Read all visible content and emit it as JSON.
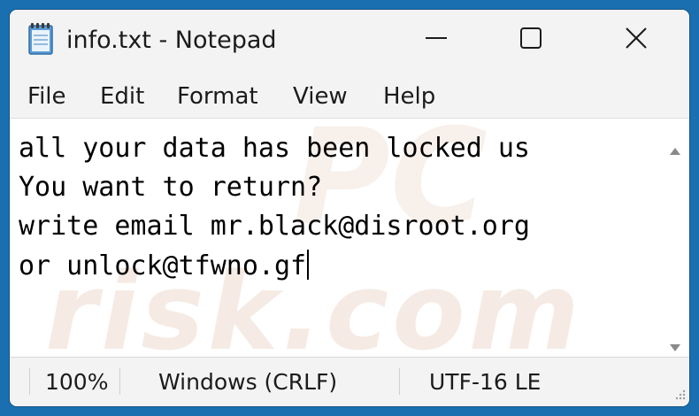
{
  "window": {
    "title": "info.txt - Notepad"
  },
  "menu": {
    "items": [
      "File",
      "Edit",
      "Format",
      "View",
      "Help"
    ]
  },
  "editor": {
    "lines": [
      "all your data has been locked us",
      "You want to return?",
      "write email mr.black@disroot.org",
      "or unlock@tfwno.gf"
    ]
  },
  "watermark": {
    "text1": "PC",
    "text2": "risk.com"
  },
  "status": {
    "zoom": "100%",
    "line_ending": "Windows (CRLF)",
    "encoding": "UTF-16 LE"
  },
  "icons": {
    "app": "notepad-icon",
    "minimize": "minimize-icon",
    "maximize": "maximize-icon",
    "close": "close-icon",
    "scroll_up": "scroll-up-arrow-icon",
    "scroll_down": "scroll-down-arrow-icon",
    "grip": "resize-grip-icon"
  },
  "colors": {
    "desktop": "#1a6fb0",
    "window_bg": "#f3f3f3",
    "editor_bg": "#ffffff"
  }
}
